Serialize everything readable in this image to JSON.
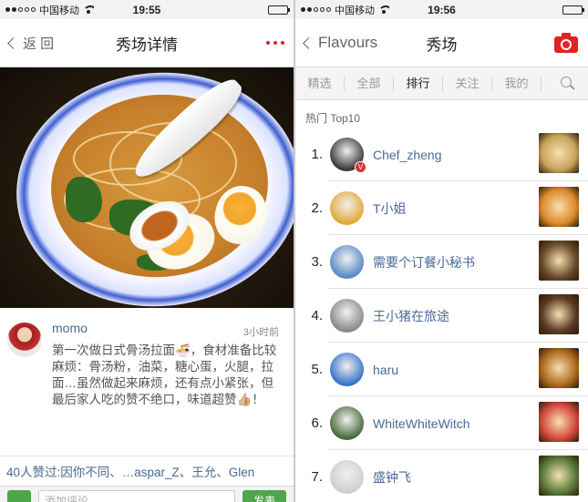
{
  "left": {
    "status": {
      "carrier": "中国移动",
      "time": "19:55",
      "battery_level": 0.7
    },
    "nav": {
      "back_label": "返 回",
      "title": "秀场详情"
    },
    "post": {
      "username": "momo",
      "time_ago": "3小时前",
      "text": "第一次做日式骨汤拉面🍜，食材准备比较麻烦：骨汤粉，油菜，糖心蛋，火腿，拉面…虽然做起来麻烦，还有点小紧张，但最后家人吃的赞不绝口，味道超赞👍🏼！",
      "likes_text": "40人赞过:因你不同、…aspar_Z、王允、Glen"
    },
    "comment": {
      "placeholder": "添加评论",
      "send_label": "发表"
    }
  },
  "right": {
    "status": {
      "carrier": "中国移动",
      "time": "19:56",
      "battery_level": 0.7
    },
    "nav": {
      "back_label": "Flavours",
      "title": "秀场"
    },
    "tabs": [
      "精选",
      "全部",
      "排行",
      "关注",
      "我的"
    ],
    "active_tab": "排行",
    "section_title": "热门 Top10",
    "ranking": [
      {
        "rank": "1.",
        "name": "Chef_zheng",
        "verified": true,
        "avatar_color": "#3a3a3a",
        "thumb_color": "#c9a25a"
      },
      {
        "rank": "2.",
        "name": "T小姐",
        "verified": false,
        "avatar_color": "#e2a93a",
        "thumb_color": "#e08a2a"
      },
      {
        "rank": "3.",
        "name": "需要个订餐小秘书",
        "verified": false,
        "avatar_color": "#5a8ac8",
        "thumb_color": "#6a4a2a"
      },
      {
        "rank": "4.",
        "name": "王小猪在旅途",
        "verified": false,
        "avatar_color": "#8a8a8a",
        "thumb_color": "#5a3a22"
      },
      {
        "rank": "5.",
        "name": "haru",
        "verified": false,
        "avatar_color": "#3a74c9",
        "thumb_color": "#b06a1e"
      },
      {
        "rank": "6.",
        "name": "WhiteWhiteWitch",
        "verified": false,
        "avatar_color": "#4a6a3a",
        "thumb_color": "#d64a3a"
      },
      {
        "rank": "7.",
        "name": "盛钟飞",
        "verified": false,
        "avatar_color": "#cfcfcf",
        "thumb_color": "#5a7a3a"
      }
    ]
  }
}
